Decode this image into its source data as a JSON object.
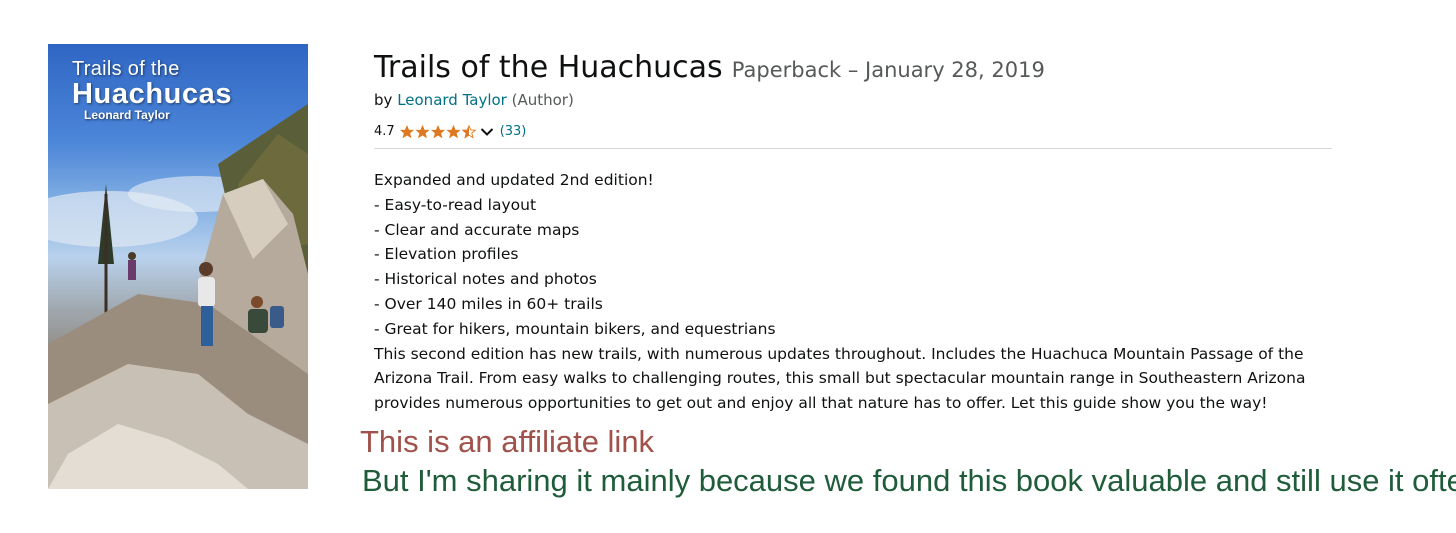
{
  "cover": {
    "title_line1": "Trails of the",
    "title_line2": "Huachucas",
    "author": "Leonard Taylor"
  },
  "product": {
    "title": "Trails of the Huachucas",
    "format_date": "Paperback – January 28, 2019",
    "by_prefix": "by",
    "author": "Leonard Taylor",
    "author_role": "(Author)",
    "rating_value": "4.7",
    "rating_stars": 4.5,
    "rating_count": "(33)"
  },
  "description": {
    "lines": [
      "Expanded and updated 2nd edition!",
      "- Easy-to-read layout",
      "- Clear and accurate maps",
      "- Elevation profiles",
      "- Historical notes and photos",
      "- Over 140 miles in 60+ trails",
      "- Great for hikers, mountain bikers, and equestrians"
    ],
    "paragraph": "This second edition has new trails, with numerous updates throughout. Includes the Huachuca Mountain Passage of the Arizona Trail. From easy walks to challenging routes, this small but spectacular mountain range in Southeastern Arizona provides numerous opportunities to get out and enjoy all that nature has to offer. Let this guide show you the way!"
  },
  "notes": {
    "affiliate": "This is an affiliate link",
    "sharing": "But I'm sharing it mainly because we found this book valuable and still use it often"
  },
  "colors": {
    "link": "#007185",
    "star": "#de7921",
    "affiliate_note": "#a0524a",
    "sharing_note": "#1f5c3a"
  }
}
